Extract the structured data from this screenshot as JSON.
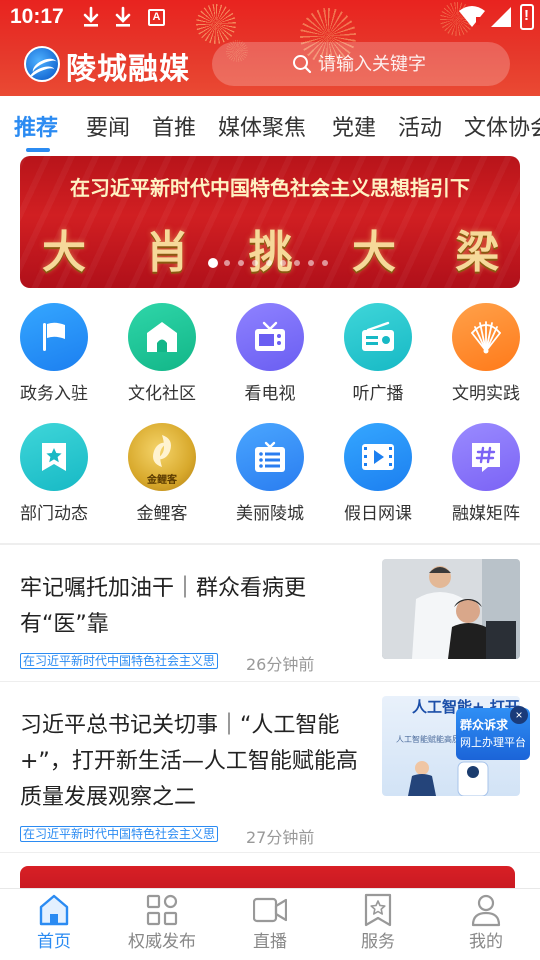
{
  "status_bar": {
    "time": "10:17",
    "notification_icons": [
      "download-icon",
      "download-icon",
      "a-badge-icon"
    ],
    "a_badge": "A"
  },
  "header": {
    "app_title": "陵城融媒",
    "search_placeholder": "请输入关键字",
    "background_color": "#e8231f"
  },
  "tabs": [
    "推荐",
    "要闻",
    "首推",
    "媒体聚焦",
    "党建",
    "活动",
    "文体协会"
  ],
  "active_tab": "推荐",
  "banner": {
    "line1": "在习近平新时代中国特色社会主义思想指引下",
    "line2": "大 肖 挑 大 梁",
    "page_count": 9,
    "current_page": 1
  },
  "grid": [
    {
      "label": "政务入驻",
      "icon": "flag-icon"
    },
    {
      "label": "文化社区",
      "icon": "home-icon"
    },
    {
      "label": "看电视",
      "icon": "tv-icon"
    },
    {
      "label": "听广播",
      "icon": "radio-icon"
    },
    {
      "label": "文明实践",
      "icon": "fan-icon"
    },
    {
      "label": "部门动态",
      "icon": "star-bookmark-icon"
    },
    {
      "label": "金鲤客",
      "icon": "koi-logo-icon",
      "logo_text": "金鲤客"
    },
    {
      "label": "美丽陵城",
      "icon": "list-icon"
    },
    {
      "label": "假日网课",
      "icon": "video-icon"
    },
    {
      "label": "融媒矩阵",
      "icon": "hash-icon"
    }
  ],
  "news": [
    {
      "title": "牢记嘱托加油干｜群众看病更有“医”靠",
      "tag": "在习近平新时代中国特色社会主义思",
      "time": "26分钟前"
    },
    {
      "title": "习近平总书记关切事｜“人工智能+”，打开新生活—人工智能赋能高质量发展观察之二",
      "tag": "在习近平新时代中国特色社会主义思",
      "time": "27分钟前",
      "thumb_text": "人工智能+ 打开新",
      "thumb_subtext": "人工智能赋能高质"
    }
  ],
  "float_badge": {
    "line1": "群众诉求",
    "line2": "网上办理平台",
    "close": "×"
  },
  "bottom_nav": [
    {
      "label": "首页",
      "icon": "home-outline-icon",
      "active": true
    },
    {
      "label": "权威发布",
      "icon": "grid-icon",
      "active": false
    },
    {
      "label": "直播",
      "icon": "video-camera-icon",
      "active": false
    },
    {
      "label": "服务",
      "icon": "bookmark-star-icon",
      "active": false
    },
    {
      "label": "我的",
      "icon": "user-icon",
      "active": false
    }
  ],
  "colors": {
    "accent": "#2b8bf2",
    "header_red": "#e8231f",
    "text": "#222222",
    "muted": "#999999"
  }
}
